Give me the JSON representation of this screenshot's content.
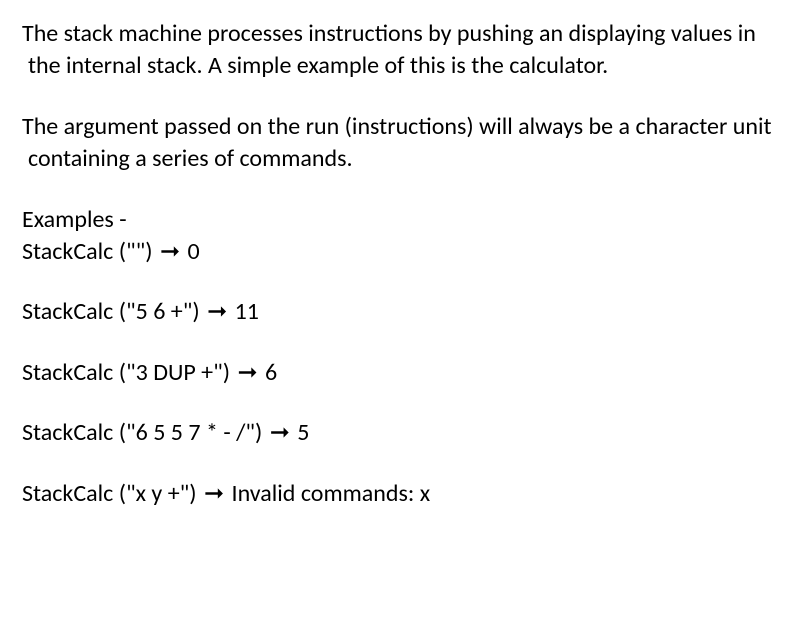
{
  "intro": {
    "p1": "The stack machine processes instructions by pushing an displaying values in the internal stack. A simple example of this is the calculator.",
    "p2": "The argument passed on the run (instructions) will always be a character unit containing a series of commands."
  },
  "examples": {
    "heading": "Examples -",
    "arrow": "➞",
    "items": [
      {
        "call": "StackCalc (\"\")",
        "result": "0"
      },
      {
        "call": "StackCalc (\"5 6 +\")",
        "result": "11"
      },
      {
        "call": "StackCalc (\"3 DUP +\")",
        "result": "6"
      },
      {
        "call": "StackCalc (\"6 5 5 7 * - /\")",
        "result": "5"
      },
      {
        "call": "StackCalc (\"x y +\")",
        "result": "Invalid commands: x"
      }
    ]
  }
}
